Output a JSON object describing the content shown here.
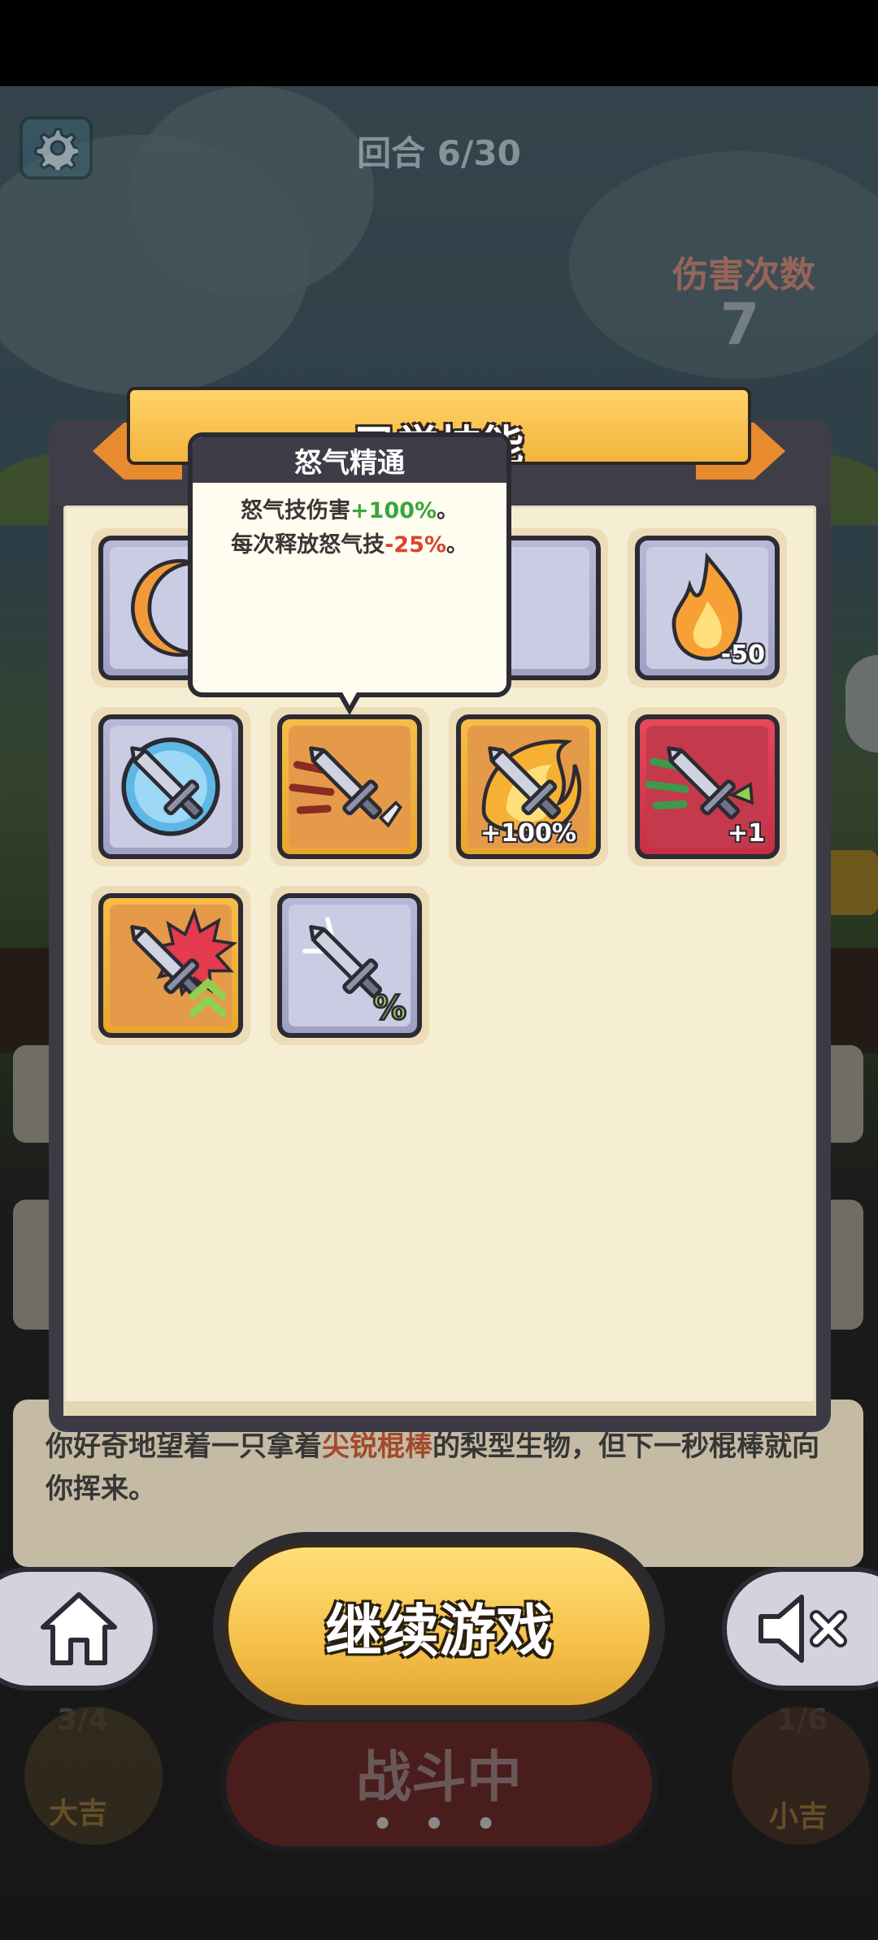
{
  "hud": {
    "round_text": "回合 6/30",
    "damage_label": "伤害次数",
    "damage_count": "7"
  },
  "story": {
    "part1": "你好奇地望着一只拿着",
    "highlight": "尖锐棍棒",
    "part2": "的梨型生物，但下一秒棍棒就向你挥来。"
  },
  "bottom": {
    "continue_label": "继续游戏",
    "battle_label": "战斗中",
    "battle_dots": "• • •",
    "left_count": "3/4",
    "left_label": "大吉",
    "right_count": "1/6",
    "right_label": "小吉"
  },
  "panel": {
    "title": "已学技能",
    "skills": [
      {
        "icon": "crescent-moon-icon",
        "tier": "gray",
        "badge": ""
      },
      {
        "icon": "hidden-skill-icon",
        "tier": "gray",
        "badge": ""
      },
      {
        "icon": "hidden-skill-icon",
        "tier": "gray",
        "badge": ""
      },
      {
        "icon": "flame-icon",
        "tier": "gray",
        "badge": "-50"
      },
      {
        "icon": "sword-bubble-icon",
        "tier": "gray",
        "badge": ""
      },
      {
        "icon": "dash-sword-icon",
        "tier": "gold",
        "badge": ""
      },
      {
        "icon": "fire-sword-icon",
        "tier": "gold",
        "badge": "+100%"
      },
      {
        "icon": "sword-plus-icon",
        "tier": "red",
        "badge": "+1"
      },
      {
        "icon": "sword-burst-icon",
        "tier": "gold",
        "badge": ""
      },
      {
        "icon": "broken-sword-percent-icon",
        "tier": "gray",
        "badge": ""
      }
    ]
  },
  "tooltip": {
    "title": "怒气精通",
    "line1_prefix": "怒气技伤害",
    "line1_value": "+100%",
    "line1_suffix": "。",
    "line2_prefix": "每次释放怒气技",
    "line2_value": "-25%",
    "line2_suffix": "。"
  },
  "colors": {
    "positive": "#3ca33f",
    "negative": "#d9432f",
    "ribbon": "#f3b43c",
    "continue": "#f6c24b"
  }
}
